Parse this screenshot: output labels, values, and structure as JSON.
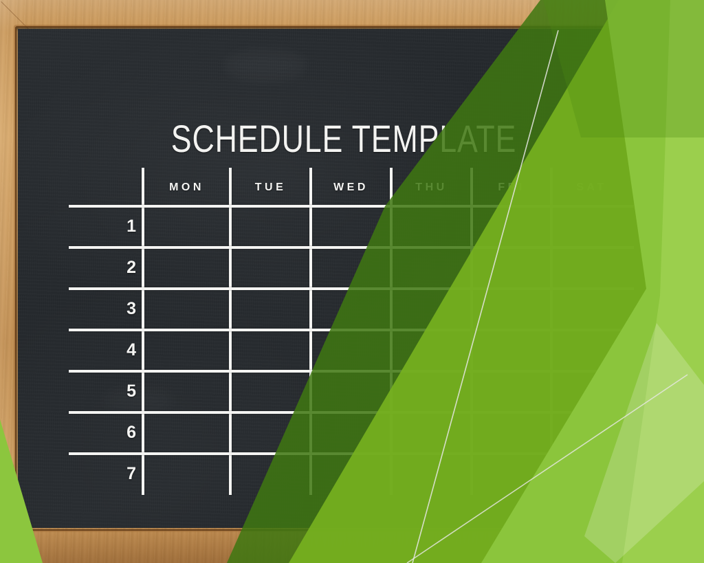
{
  "board": {
    "title": "SCHEDULE TEMPLATE",
    "board_color": "#272b2f",
    "frame_color": "#c6914f",
    "chalk_color": "#f4f4f2"
  },
  "schedule": {
    "day_headers": [
      "MON",
      "TUE",
      "WED",
      "THU",
      "FRI",
      "SAT"
    ],
    "row_numbers": [
      "1",
      "2",
      "3",
      "4",
      "5",
      "6",
      "7"
    ]
  },
  "decor": {
    "accent_green_bright": "#8cc63e",
    "accent_green_mid": "#76b120",
    "accent_green_dark": "#3f7711",
    "accent_green_pale": "#aed47a",
    "diagonal_line_color": "#e8e8e6"
  }
}
